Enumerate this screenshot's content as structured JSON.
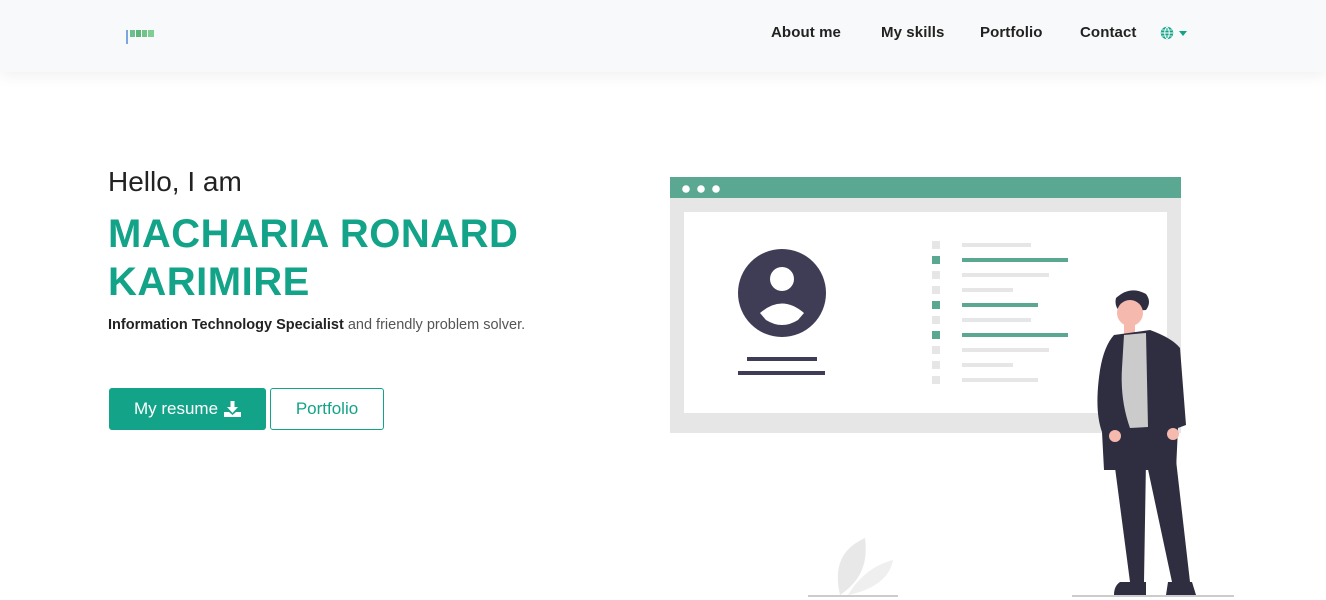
{
  "navbar": {
    "logo_icon": "logo-bars-icon",
    "links": [
      "About me",
      "My skills",
      "Portfolio",
      "Contact"
    ],
    "language_icon": "globe-icon",
    "language_caret_icon": "caret-down-icon"
  },
  "hero": {
    "greeting": "Hello, I am",
    "name_line1": "MACHARIA RONARD",
    "name_line2": "KARIMIRE",
    "tagline_strong": "Information Technology Specialist",
    "tagline_rest": " and friendly problem solver.",
    "resume_button": "My resume",
    "resume_icon": "download-icon",
    "portfolio_button": "Portfolio"
  },
  "colors": {
    "accent": "#13a388",
    "illustration_green": "#5aa892",
    "illustration_dark": "#3f3d56",
    "navbar_bg": "#f8f9fa"
  }
}
